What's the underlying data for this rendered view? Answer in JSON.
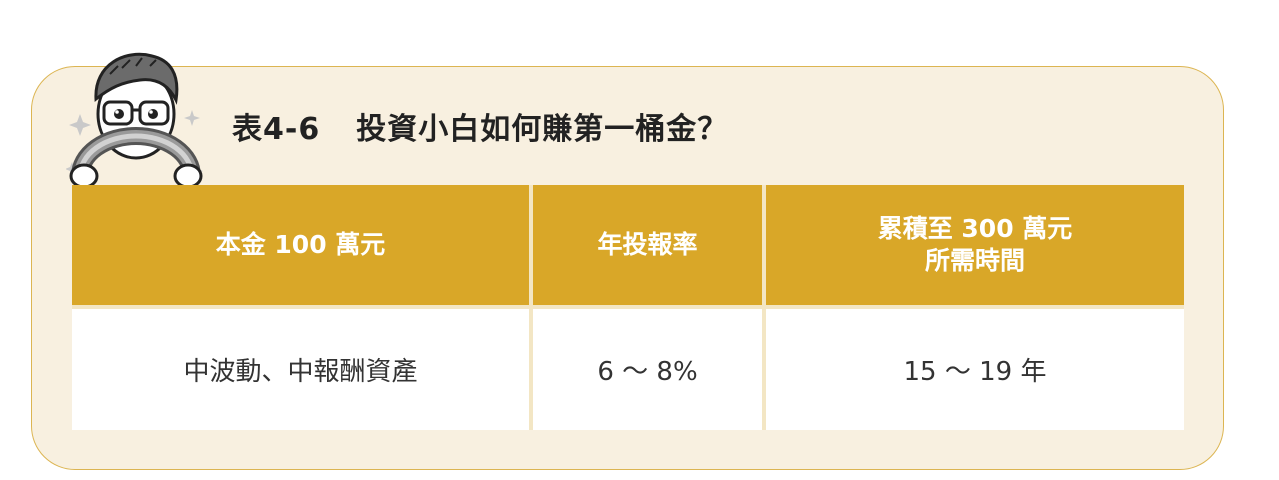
{
  "title": {
    "number": "表4-6",
    "text": "投資小白如何賺第一桶金？"
  },
  "table": {
    "headers": [
      "本金 100 萬元",
      "年投報率",
      [
        "累積至 300 萬元",
        "所需時間"
      ]
    ],
    "rows": [
      [
        "中波動、中報酬資產",
        "6 ～ 8%",
        "15 ～ 19 年"
      ]
    ]
  },
  "colors": {
    "panel_bg": "#f8f0e0",
    "panel_border": "#dcb552",
    "header_bg": "#d9a728",
    "header_text": "#ffffff"
  },
  "icons": [
    "mascot-icon"
  ]
}
